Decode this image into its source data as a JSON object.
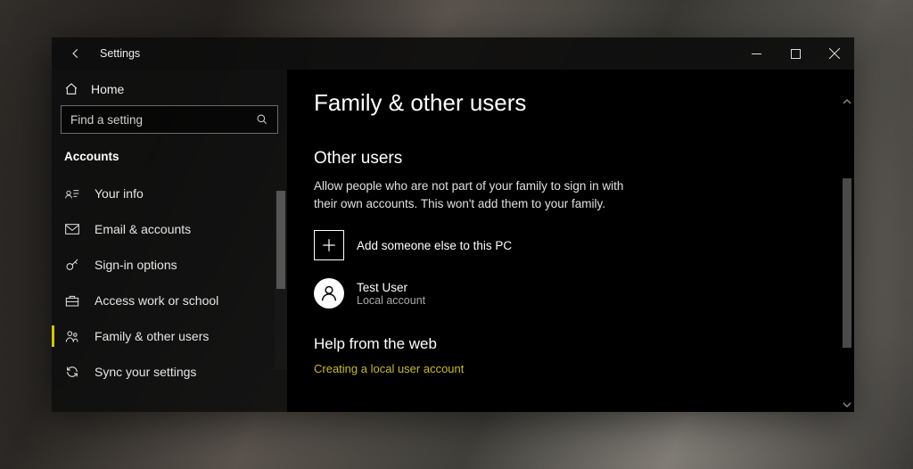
{
  "window": {
    "title": "Settings"
  },
  "sidebar": {
    "home_label": "Home",
    "search_placeholder": "Find a setting",
    "section_label": "Accounts",
    "items": [
      {
        "label": "Your info",
        "icon": "your-info-icon",
        "active": false
      },
      {
        "label": "Email & accounts",
        "icon": "email-icon",
        "active": false
      },
      {
        "label": "Sign-in options",
        "icon": "key-icon",
        "active": false
      },
      {
        "label": "Access work or school",
        "icon": "briefcase-icon",
        "active": false
      },
      {
        "label": "Family & other users",
        "icon": "family-icon",
        "active": true
      },
      {
        "label": "Sync your settings",
        "icon": "sync-icon",
        "active": false
      }
    ]
  },
  "main": {
    "page_title": "Family & other users",
    "other_users": {
      "heading": "Other users",
      "description": "Allow people who are not part of your family to sign in with their own accounts. This won't add them to your family.",
      "add_label": "Add someone else to this PC",
      "users": [
        {
          "name": "Test User",
          "type": "Local account"
        }
      ]
    },
    "help": {
      "heading": "Help from the web",
      "links": [
        "Creating a local user account"
      ]
    }
  }
}
